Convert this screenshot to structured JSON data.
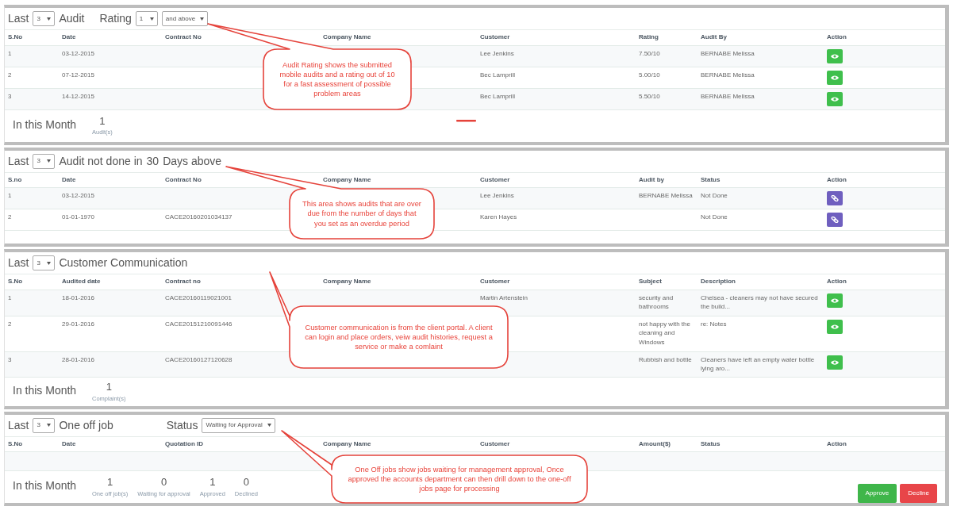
{
  "sections": [
    {
      "header": [
        {
          "kind": "text",
          "text": "Last"
        },
        {
          "kind": "select",
          "value": "3"
        },
        {
          "kind": "text",
          "text": "Audit"
        },
        {
          "kind": "filter",
          "text": "Rating"
        },
        {
          "kind": "select",
          "value": "1"
        },
        {
          "kind": "select",
          "value": "and above"
        }
      ],
      "columns": [
        "S.No",
        "Date",
        "Contract No",
        "Company Name",
        "Customer",
        "Rating",
        "Audit By",
        "Action"
      ],
      "rows": [
        {
          "cells": [
            "1",
            "03-12-2015",
            null,
            null,
            "Lee Jenkins",
            "7.50/10",
            "BERNABE Melissa"
          ],
          "kind": "view"
        },
        {
          "cells": [
            "2",
            "07-12-2015",
            null,
            null,
            "Bec Lamprill",
            "5.00/10",
            "BERNABE Melissa"
          ],
          "kind": "view"
        },
        {
          "cells": [
            "3",
            "14-12-2015",
            null,
            null,
            "Bec Lamprill",
            "5.50/10",
            "BERNABE Melissa"
          ],
          "kind": "view"
        }
      ],
      "summary": {
        "label": "In this Month",
        "stats": [
          {
            "value": "1",
            "caption": "Audit(s)"
          }
        ]
      },
      "callout": "Audit Rating shows the submitted mobile audits and a rating out of 10 for a fast assessment of possible problem areas"
    },
    {
      "header": [
        {
          "kind": "text",
          "text": "Last"
        },
        {
          "kind": "select",
          "value": "3"
        },
        {
          "kind": "text",
          "text": "Audit not done in"
        },
        {
          "kind": "text",
          "text": "30"
        },
        {
          "kind": "text",
          "text": "Days above"
        }
      ],
      "columns": [
        "S.no",
        "Date",
        "Contract No",
        "Company Name",
        "Customer",
        "Audit by",
        "Status",
        "Action"
      ],
      "rows": [
        {
          "cells": [
            "1",
            "03-12-2015",
            null,
            null,
            "Lee Jenkins",
            "BERNABE Melissa",
            "Not Done"
          ],
          "kind": "link"
        },
        {
          "cells": [
            "2",
            "01-01-1970",
            "CACE20160201034137",
            null,
            "Karen Hayes",
            null,
            "Not Done"
          ],
          "kind": "link"
        }
      ],
      "callout": "This area shows audits that are over due from the number of days that you set as an overdue period"
    },
    {
      "header": [
        {
          "kind": "text",
          "text": "Last"
        },
        {
          "kind": "select",
          "value": "3"
        },
        {
          "kind": "text",
          "text": "Customer Communication"
        }
      ],
      "columns": [
        "S.No",
        "Audited date",
        "Contract no",
        "Company Name",
        "Customer",
        "Subject",
        "Description",
        "Action"
      ],
      "rows": [
        {
          "cells": [
            "1",
            "18-01-2016",
            "CACE20160119021001",
            null,
            "Martin Artenstein",
            "security and bathrooms",
            "Chelsea - cleaners may not have secured the build..."
          ],
          "kind": "view"
        },
        {
          "cells": [
            "2",
            "29-01-2016",
            "CACE20151210091446",
            null,
            null,
            "not happy with the cleaning and Windows",
            "re: Notes"
          ],
          "kind": "view"
        },
        {
          "cells": [
            "3",
            "28-01-2016",
            "CACE20160127120628",
            null,
            null,
            "Rubbish and bottle",
            "Cleaners have left an empty water bottle lying aro..."
          ],
          "kind": "view"
        }
      ],
      "summary": {
        "label": "In this Month",
        "stats": [
          {
            "value": "1",
            "caption": "Complaint(s)"
          }
        ]
      },
      "callout": "Customer communication is from the client portal. A client can login and place orders, veiw audit histories, request a service or make a comlaint"
    },
    {
      "header": [
        {
          "kind": "text",
          "text": "Last"
        },
        {
          "kind": "select",
          "value": "3"
        },
        {
          "kind": "text",
          "text": "One off job"
        },
        {
          "kind": "filter",
          "text": "Status"
        },
        {
          "kind": "select",
          "value": "Waiting for Approval"
        }
      ],
      "columns": [
        "S.No",
        "Date",
        "Quotation ID",
        "Company Name",
        "Customer",
        "Amount($)",
        "Status",
        "Action"
      ],
      "summary": {
        "label": "In this Month",
        "stats": [
          {
            "value": "1",
            "caption": "One off job(s)"
          },
          {
            "value": "0",
            "caption": "Waiting for approval"
          },
          {
            "value": "1",
            "caption": "Approved"
          },
          {
            "value": "0",
            "caption": "Declined"
          }
        ],
        "buttons": [
          {
            "label": "Approve",
            "kind": "approve"
          },
          {
            "label": "Decline",
            "kind": "decline"
          }
        ]
      },
      "callout": "One Off jobs show jobs waiting for management approval, Once approved the accounts department can then drill down to the one-off jobs page for processing"
    }
  ]
}
